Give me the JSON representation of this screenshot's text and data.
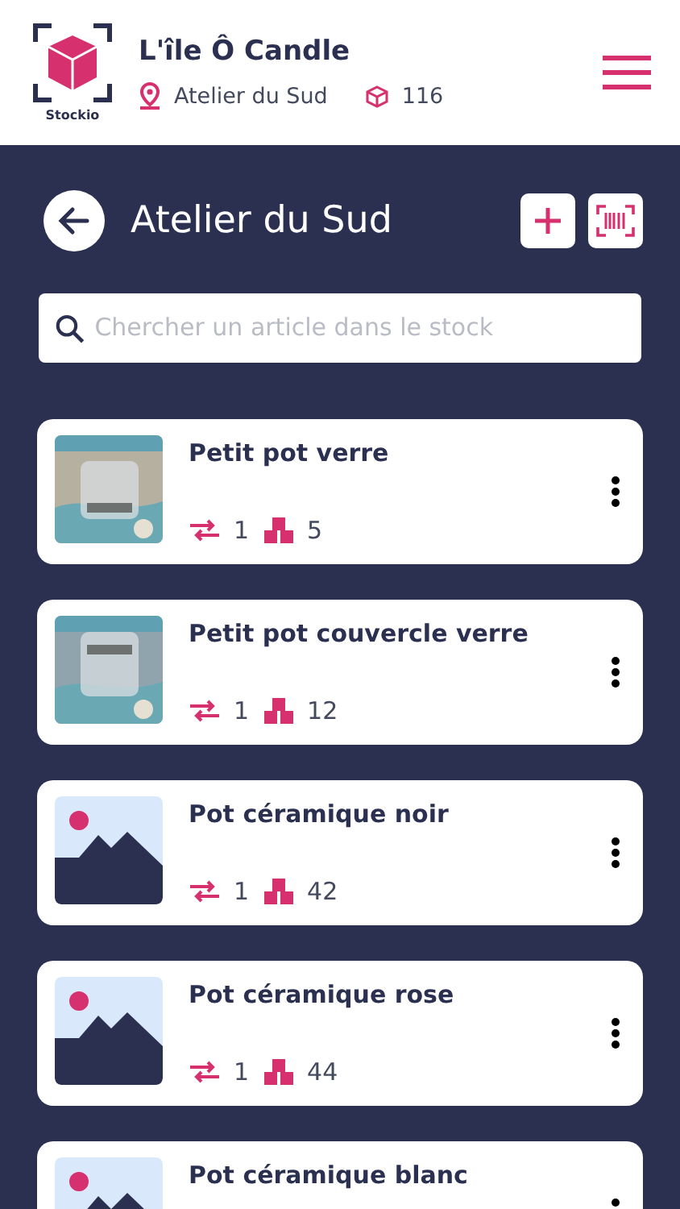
{
  "app": {
    "logo_text": "Stockio",
    "shop_name": "L'île Ô Candle",
    "location": "Atelier du Sud",
    "item_count": "116"
  },
  "page": {
    "title": "Atelier du Sud"
  },
  "search": {
    "placeholder": "Chercher un article dans le stock"
  },
  "items": [
    {
      "name": "Petit pot verre",
      "kind": "picture",
      "transfers": "1",
      "stock": "5"
    },
    {
      "name": "Petit pot couvercle verre",
      "kind": "picture",
      "transfers": "1",
      "stock": "12"
    },
    {
      "name": "Pot céramique noir",
      "kind": "placeholder",
      "transfers": "1",
      "stock": "42"
    },
    {
      "name": "Pot céramique rose",
      "kind": "placeholder",
      "transfers": "1",
      "stock": "44"
    },
    {
      "name": "Pot céramique blanc",
      "kind": "placeholder"
    }
  ]
}
